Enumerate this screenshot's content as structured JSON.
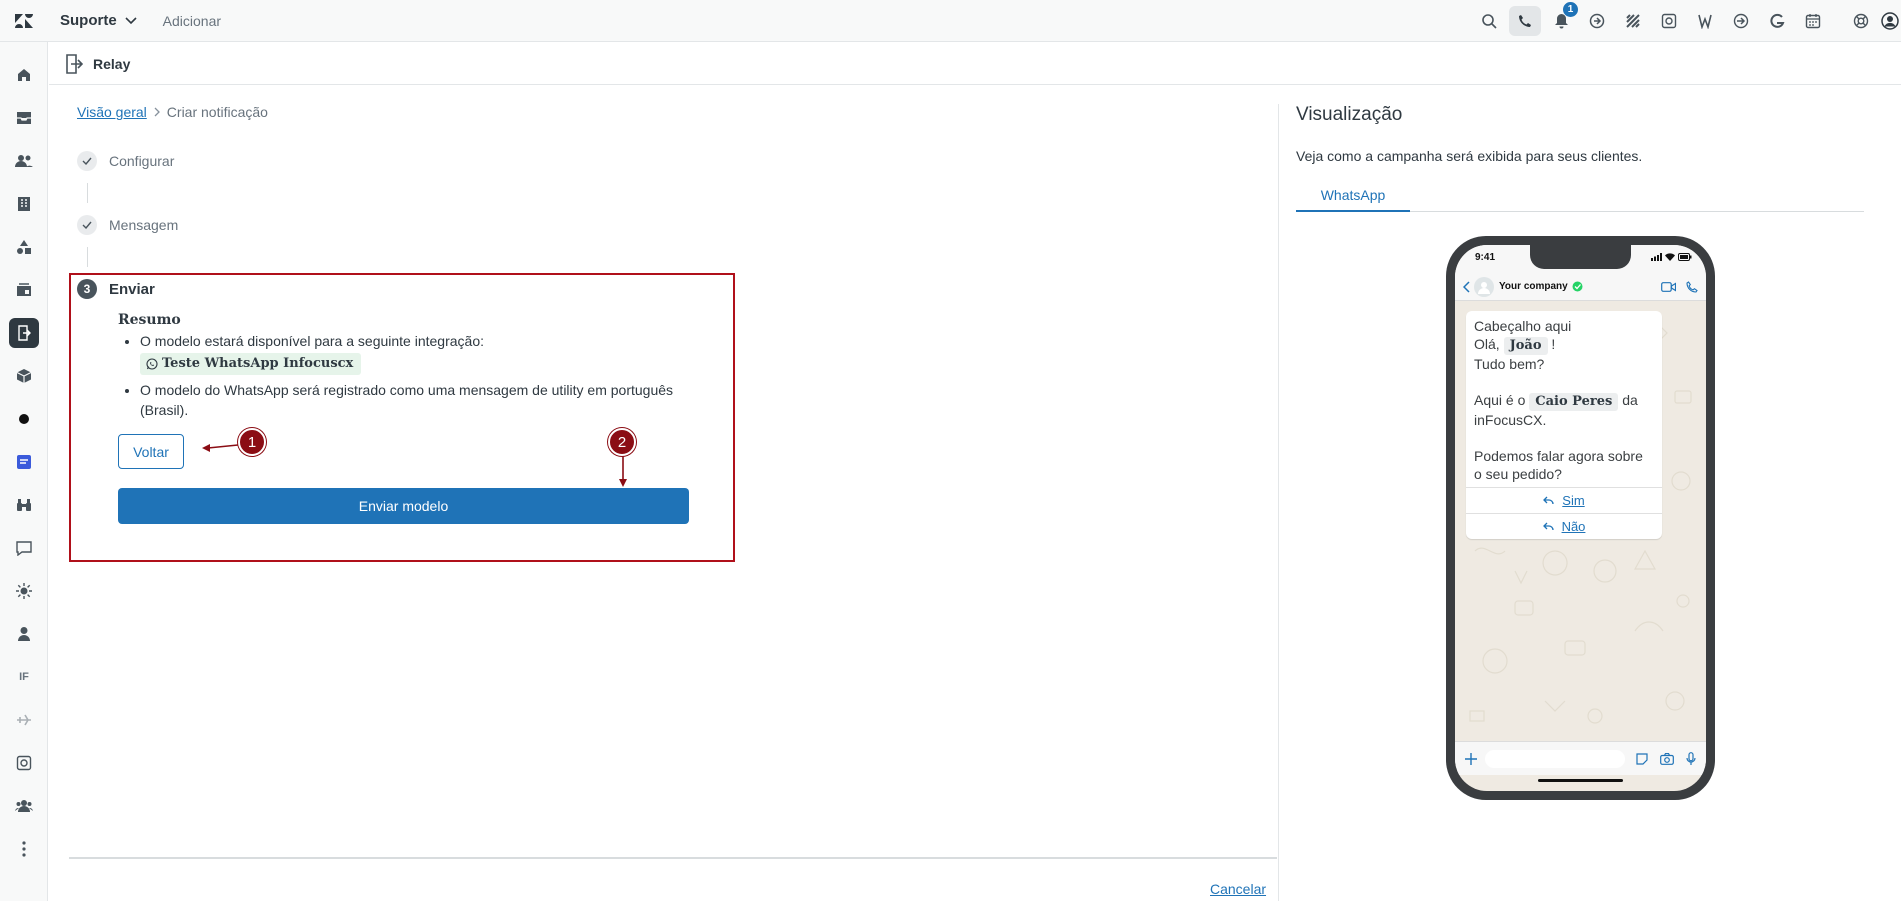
{
  "topbar": {
    "product": "Suporte",
    "add_label": "Adicionar",
    "notification_count": "1",
    "icons": [
      "search-icon",
      "phone-icon",
      "bell-icon",
      "app-icon",
      "grid-icon",
      "photo-icon",
      "w-icon",
      "arrow-circle-icon",
      "g-icon",
      "calendar-icon",
      "lifebuoy-icon",
      "user-avatar-icon"
    ]
  },
  "leftnav": {
    "items": [
      "home-icon",
      "inbox-icon",
      "users-icon",
      "buildings-icon",
      "shapes-icon",
      "tray-icon",
      "relay-icon",
      "box-icon",
      "dot-icon",
      "blue-app-icon",
      "binoculars-icon",
      "chat-icon",
      "sun-icon",
      "person-icon",
      "IF",
      "plane-icon",
      "image-icon",
      "group-icon",
      "more-icon"
    ],
    "if_label": "IF"
  },
  "subheader": {
    "title": "Relay"
  },
  "breadcrumb": {
    "link": "Visão geral",
    "current": "Criar notificação"
  },
  "steps": {
    "configure": "Configurar",
    "message": "Mensagem",
    "send_number": "3",
    "send": "Enviar"
  },
  "summary": {
    "heading": "Resumo",
    "item1": "O modelo estará disponível para a seguinte integração:",
    "integration": "Teste WhatsApp Infocuscx",
    "item2": "O modelo do WhatsApp será registrado como uma mensagem de utility em português (Brasil)."
  },
  "buttons": {
    "back": "Voltar",
    "send_template": "Enviar modelo",
    "cancel": "Cancelar"
  },
  "annotations": {
    "marker1": "1",
    "marker2": "2"
  },
  "preview": {
    "title": "Visualização",
    "description": "Veja como a campanha será exibida para seus clientes.",
    "tab": "WhatsApp",
    "phone": {
      "time": "9:41",
      "company": "Your company",
      "header_line": "Cabeçalho aqui",
      "greeting_pre": "Olá,",
      "name_var": "João",
      "greeting_post": "!",
      "line2": "Tudo bem?",
      "agent_pre": "Aqui é o",
      "agent_var": "Caio Peres",
      "agent_post": "da",
      "company_line": "inFocusCX.",
      "question": "Podemos falar agora sobre o seu pedido?",
      "reply_yes": "Sim",
      "reply_no": "Não"
    }
  },
  "colors": {
    "accent": "#1f73b7",
    "highlight_border": "#b0101a",
    "marker": "#8b0d14"
  }
}
